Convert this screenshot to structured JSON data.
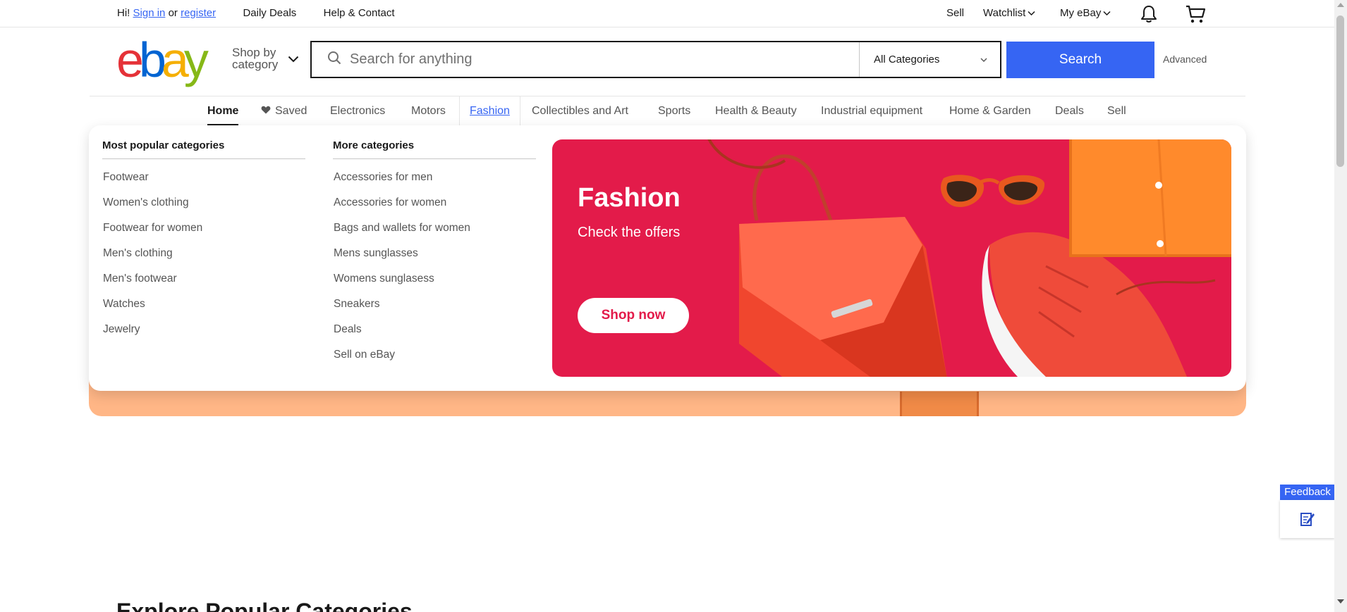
{
  "top_bar": {
    "greeting": "Hi!",
    "sign_in": "Sign in",
    "or": "or",
    "register": "register",
    "daily_deals": "Daily Deals",
    "help_contact": "Help & Contact",
    "sell": "Sell",
    "watchlist": "Watchlist",
    "my_ebay": "My eBay"
  },
  "header": {
    "logo_letters": [
      "e",
      "b",
      "a",
      "y"
    ],
    "logo_colors": [
      "#e53238",
      "#0064d2",
      "#f5af02",
      "#86b817"
    ],
    "shop_by_line1": "Shop by",
    "shop_by_line2": "category",
    "search_placeholder": "Search for anything",
    "category_selected": "All Categories",
    "search_button": "Search",
    "advanced": "Advanced"
  },
  "nav": {
    "items": [
      "Home",
      "Saved",
      "Electronics",
      "Motors",
      "Fashion",
      "Collectibles and Art",
      "Sports",
      "Health & Beauty",
      "Industrial equipment",
      "Home & Garden",
      "Deals",
      "Sell"
    ]
  },
  "dropdown": {
    "popular_title": "Most popular categories",
    "popular_items": [
      "Footwear",
      "Women's clothing",
      "Footwear for women",
      "Men's clothing",
      "Men's footwear",
      "Watches",
      "Jewelry"
    ],
    "more_title": "More categories",
    "more_items": [
      "Accessories for men",
      "Accessories for women",
      "Bags and wallets for women",
      "Mens sunglasses",
      "Womens sunglasess",
      "Sneakers",
      "Deals",
      "Sell on eBay"
    ],
    "promo": {
      "title": "Fashion",
      "subtitle": "Check the offers",
      "button": "Shop now",
      "background": "#e31b4a"
    }
  },
  "bottom": {
    "explore_title": "Explore Popular Categories"
  },
  "feedback": {
    "label": "Feedback"
  },
  "colors": {
    "accent": "#3665f3",
    "hero_peach": "#ffb686"
  }
}
